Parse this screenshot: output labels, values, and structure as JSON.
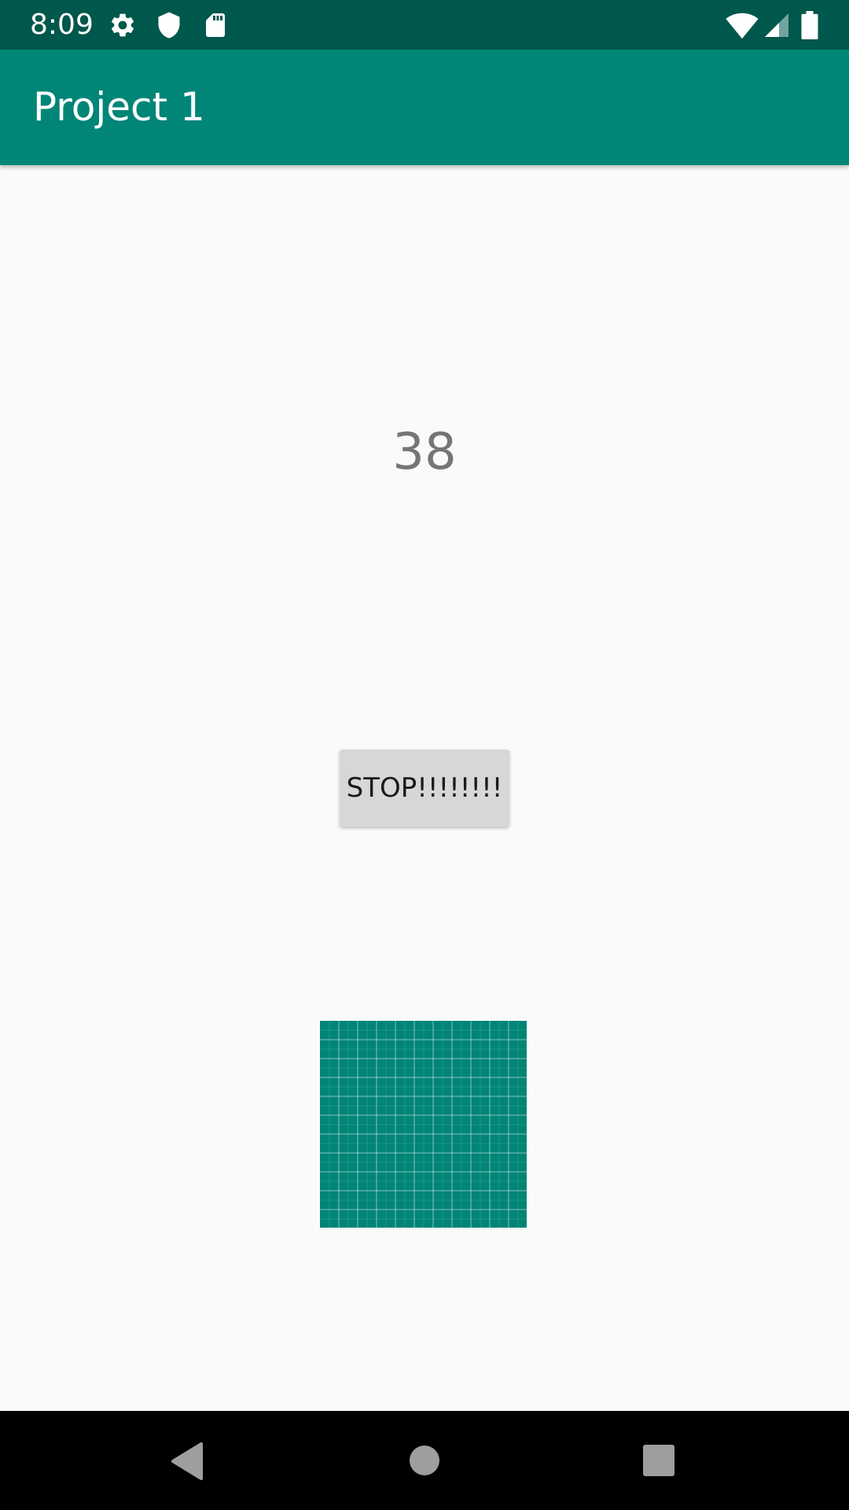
{
  "status_bar": {
    "time": "8:09",
    "left_icons": [
      "gear-icon",
      "shield-icon",
      "sd-card-icon"
    ],
    "right_icons": [
      "wifi-icon",
      "cell-signal-icon",
      "battery-icon"
    ],
    "color": "#00574b"
  },
  "app_bar": {
    "title": "Project 1",
    "color": "#008577"
  },
  "main": {
    "counter_value": "38",
    "stop_button_label": "STOP!!!!!!!!",
    "grid_color": "#008577"
  },
  "nav_bar": {
    "buttons": [
      "back-icon",
      "home-icon",
      "recents-icon"
    ]
  }
}
